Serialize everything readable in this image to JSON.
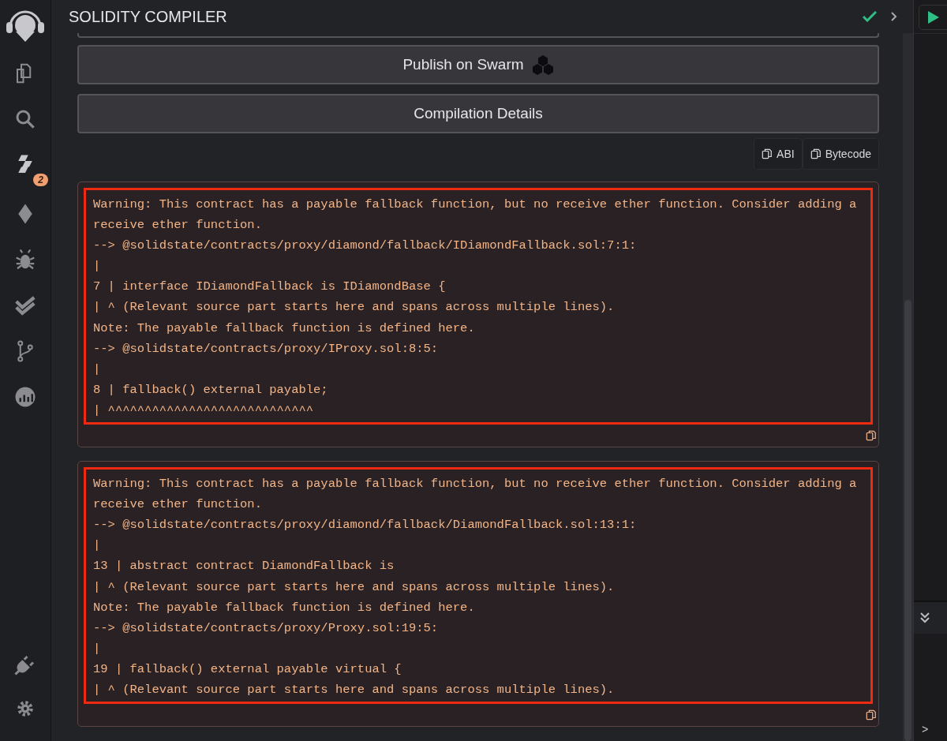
{
  "panel": {
    "title": "SOLIDITY COMPILER"
  },
  "sidebar": {
    "badge": "2"
  },
  "buttons": [
    "Publish on Swarm",
    "Compilation Details"
  ],
  "copy_buttons": [
    "ABI",
    "Bytecode"
  ],
  "messages": [
    {
      "lines": [
        "Warning: This contract has a payable fallback function, but no receive ether function. Consider adding a receive ether function.",
        "--> @solidstate/contracts/proxy/diamond/fallback/IDiamondFallback.sol:7:1:",
        "|",
        "7 | interface IDiamondFallback is IDiamondBase {",
        "| ^ (Relevant source part starts here and spans across multiple lines).",
        "Note: The payable fallback function is defined here.",
        "--> @solidstate/contracts/proxy/IProxy.sol:8:5:",
        "|",
        "8 | fallback() external payable;",
        "| ^^^^^^^^^^^^^^^^^^^^^^^^^^^^"
      ]
    },
    {
      "lines": [
        "Warning: This contract has a payable fallback function, but no receive ether function. Consider adding a receive ether function.",
        "--> @solidstate/contracts/proxy/diamond/fallback/DiamondFallback.sol:13:1:",
        "|",
        "13 | abstract contract DiamondFallback is",
        "| ^ (Relevant source part starts here and spans across multiple lines).",
        "Note: The payable fallback function is defined here.",
        "--> @solidstate/contracts/proxy/Proxy.sol:19:5:",
        "|",
        "19 | fallback() external payable virtual {",
        "| ^ (Relevant source part starts here and spans across multiple lines)."
      ]
    }
  ],
  "terminal": {
    "prompt": ">"
  }
}
